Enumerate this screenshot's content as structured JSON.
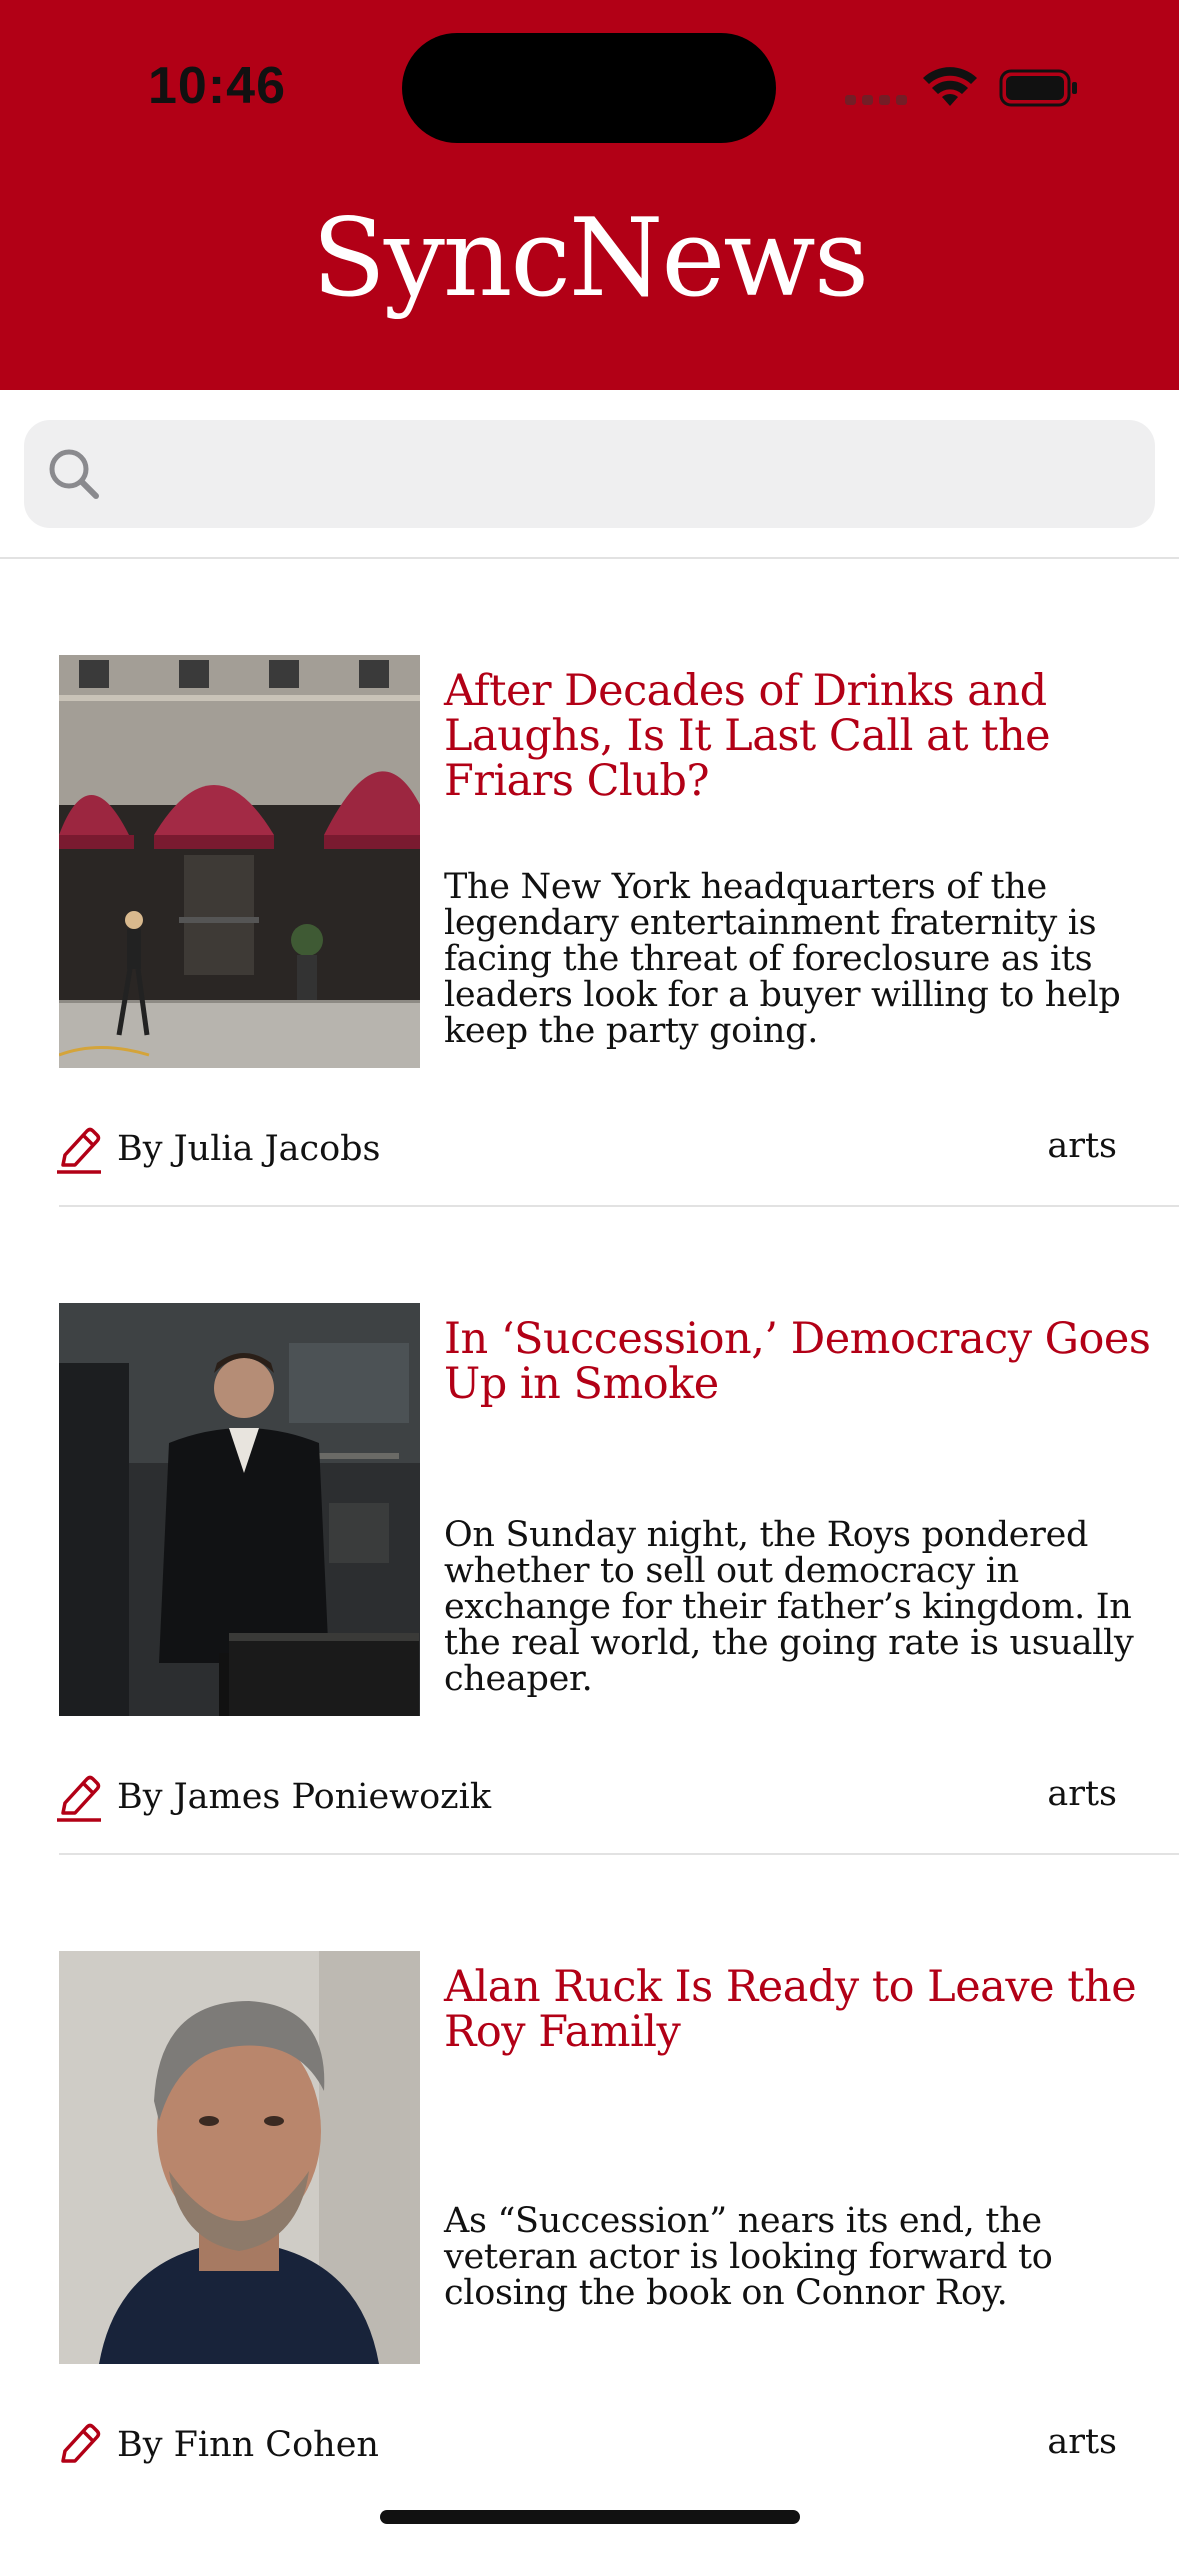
{
  "status_bar": {
    "time": "10:46"
  },
  "header": {
    "title": "SyncNews",
    "background_color": "#B20016"
  },
  "search": {
    "placeholder": "",
    "value": ""
  },
  "articles": [
    {
      "headline": "After Decades of Drinks and Laughs, Is It Last Call at the Friars Club?",
      "summary": "The New York headquarters of the legendary entertainment fraternity is facing the threat of foreclosure as its leaders look for a buyer willing to help keep the party going.",
      "author": "By Julia Jacobs",
      "category": "arts",
      "image_icon": "friars-club-facade-photo"
    },
    {
      "headline": "In ‘Succession,’ Democracy Goes Up in Smoke",
      "summary": "On Sunday night, the Roys pondered whether to sell out democracy in exchange for their father’s kingdom. In the real world, the going rate is usually cheaper.",
      "author": "By James Poniewozik",
      "category": "arts",
      "image_icon": "man-in-suit-photo"
    },
    {
      "headline": "Alan Ruck Is Ready to Leave the Roy Family",
      "summary": "As “Succession” nears its end, the veteran actor is looking forward to closing the book on Connor Roy.",
      "author": "By Finn Cohen",
      "category": "arts",
      "image_icon": "actor-portrait-photo"
    }
  ],
  "colors": {
    "accent": "#B20016",
    "text": "#111111",
    "divider": "#E2E2E2",
    "search_bg": "#EFEFF0"
  }
}
